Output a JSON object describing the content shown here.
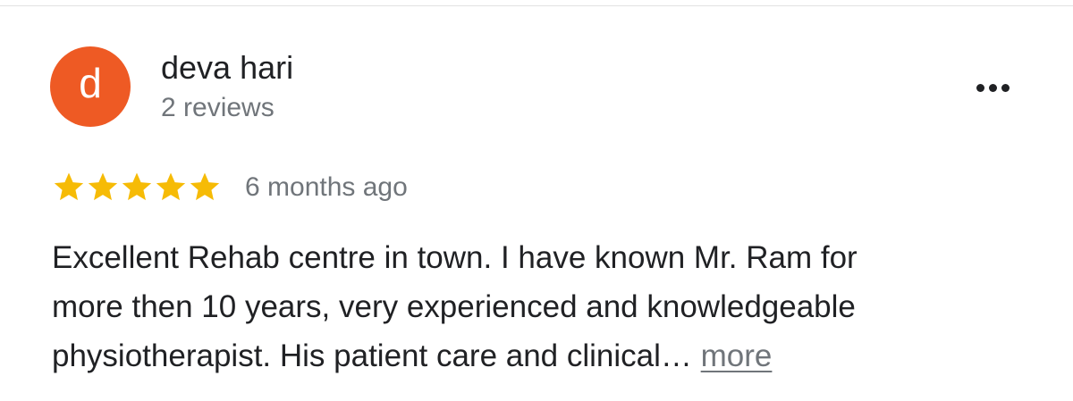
{
  "reviewer": {
    "initial": "d",
    "avatar_color": "#ee5a24",
    "name": "deva hari",
    "review_count": "2 reviews"
  },
  "menu": {
    "icon": "more-options-icon"
  },
  "review": {
    "rating": 5,
    "rating_max": 5,
    "star_color": "#f6bb06",
    "time_ago": "6 months ago",
    "text_lines": [
      "Excellent Rehab centre in town. I have known Mr. Ram for",
      "more then 10 years, very experienced and knowledgeable",
      "physiotherapist. His patient care and clinical…"
    ],
    "more_label": "more"
  }
}
